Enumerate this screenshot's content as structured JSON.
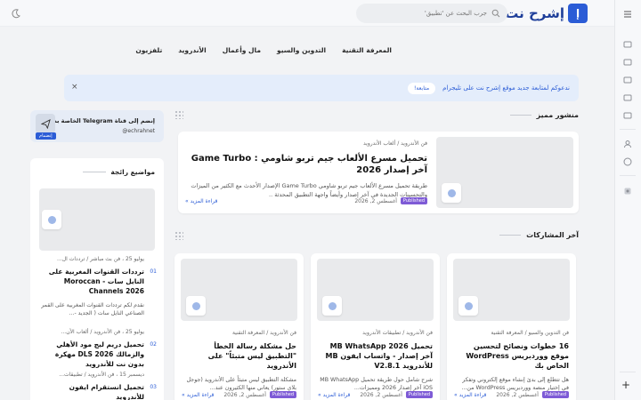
{
  "brand": {
    "logo_letter": "إ",
    "name": "إشرح نت"
  },
  "search": {
    "placeholder": "جرب البحث عن 'تطبيق'"
  },
  "nav": {
    "items": [
      {
        "label": "المعرفة التقنية"
      },
      {
        "label": "التدوين والسيو"
      },
      {
        "label": "مال وأعمال"
      },
      {
        "label": "الأندرويد"
      },
      {
        "label": "تلفزيون"
      }
    ]
  },
  "notice": {
    "text": "ندعوكم لمتابعة جديد موقع إشرح نت على تليجرام",
    "button": "متابعة!",
    "close": "×"
  },
  "featured": {
    "section_title": "منشور مميز",
    "crumb": "فن الأندرويد / ألعاب الأندرويد",
    "title": "تحميل مسرع الألعاب جيم تربو شاومي : Game Turbo آخر إصدار 2026",
    "desc": "طريقة تحميل مسرع الألعاب جيم تربو شاومي Game Turbo الإصدار الأحدث مع الكثير من الميزات والتحسينات الجديدة في آخر إصدار وأيضاً واجهة التطبيق المحدثة ..",
    "published": "Published",
    "date": "أغسطس 2, 2026",
    "read_more": "قراءة المزيد »"
  },
  "latest": {
    "section_title": "آخر المشاركات",
    "posts": [
      {
        "crumb": "فن التدوين والسيو / المعرفة التقنية",
        "title": "16 خطوات ونصائح لتحسين موقع ووردبريس WordPress الخاص بك",
        "desc": "هل تتطلع إلى بدئ إنشاء موقع إلكتروني وتفكر في إختيار منصة ووردبريس WordPress من...",
        "published": "Published",
        "date": "أغسطس 2, 2026",
        "read_more": "قراءة المزيد »"
      },
      {
        "crumb": "فن الأندرويد / تطبيقات الأندرويد",
        "title": "تحميل MB WhatsApp 2026 آخر إصدار - واتساب ايفون MB للأندرويد V2.8.1",
        "desc": "شرح شامل حول طريقة تحميل MB WhatsApp iOS آخر إصدار 2026 ومميزات...",
        "published": "Published",
        "date": "أغسطس 2, 2026",
        "read_more": "قراءة المزيد »"
      },
      {
        "crumb": "فن الأندرويد / المعرفة التقنية",
        "title": "حل مشكلة رسالة الخطأ \"التطبيق ليس متبئاً\" على الأندرويد",
        "desc": "مشكلة التطبيق ليس متبئاً على الأندرويد (جوجل بلاي ستور) يعاني منها الكثيرون عند...",
        "published": "Published",
        "date": "أغسطس 2, 2026",
        "read_more": "قراءة المزيد »"
      }
    ]
  },
  "telegram": {
    "title": "إنضم إلى قناة Telegram الخاصة بنا",
    "handle": "echrahnet@",
    "join": "إنضمام"
  },
  "trending": {
    "title": "مواضيع رائجة",
    "items": [
      {
        "num": "01",
        "crumb": "يوليو 25 ، فن بث مباشر / ترددات ال...",
        "title": "ترددات القنوات المغربية على النايل سات - Moroccan Channels 2026",
        "desc": "نقدم لكم ترددات القنوات المغربية على القمر الصناعي النايل سات ( الجديد -..."
      },
      {
        "num": "02",
        "crumb": "يوليو 25 ، فن الأندرويد / ألعاب الأن...",
        "title": "تحميل دريم ليج مود الأهلي والزمالك DLS 2026 مهكرة بدون نت للأندرويد",
        "desc": ""
      },
      {
        "num": "03",
        "crumb": "ديسمبر 15 ، فن الأندرويد / تطبيقات...",
        "title": "تحميل انستقرام ايفون للأندرويد",
        "desc": ""
      }
    ]
  }
}
